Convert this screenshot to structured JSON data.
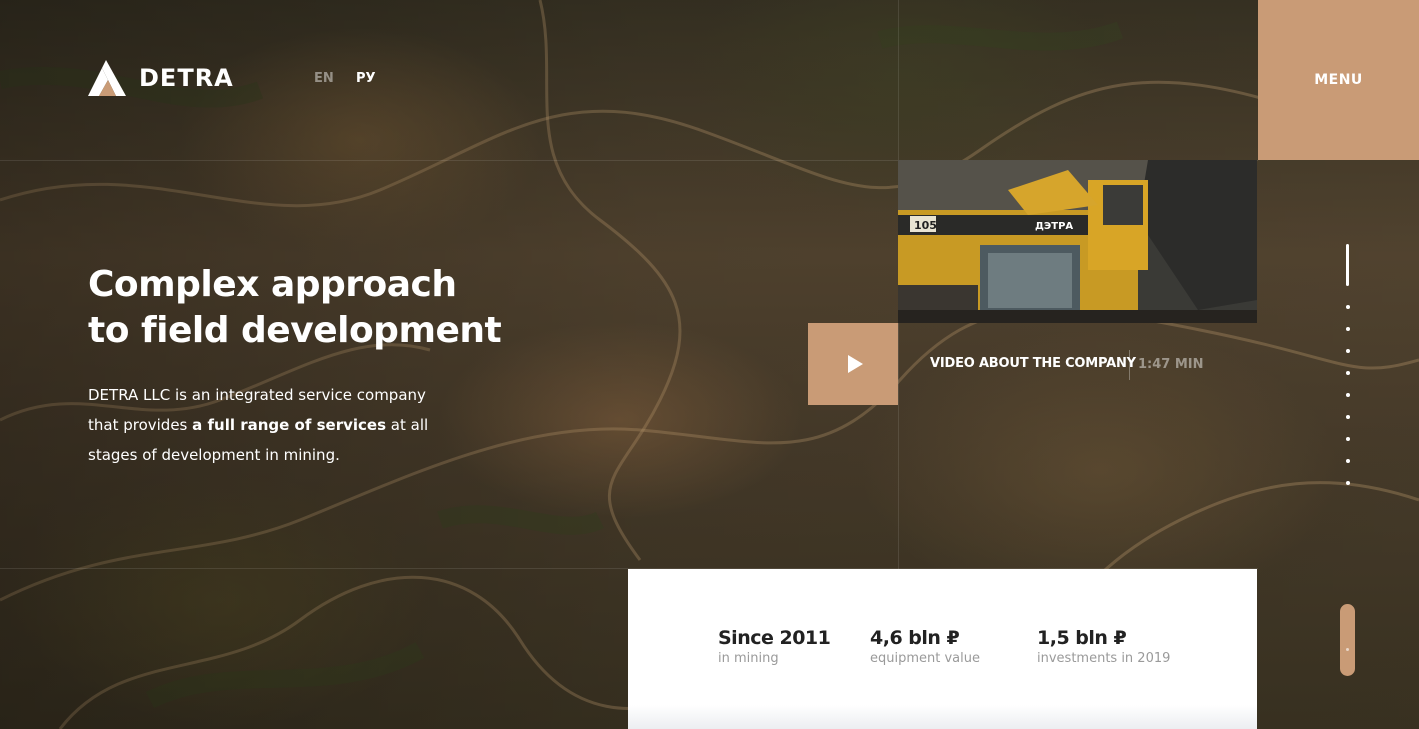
{
  "header": {
    "brand": "DETRA",
    "languages": [
      "EN",
      "РУ"
    ],
    "active_language": "РУ",
    "menu_label": "MENU"
  },
  "hero": {
    "title_line1": "Complex approach",
    "title_line2": "to field development",
    "desc_before": "DETRA LLC is an integrated service company that provides ",
    "desc_bold": "a full range of services",
    "desc_after": " at all stages of development in mining."
  },
  "video": {
    "label": "VIDEO ABOUT THE COMPANY",
    "duration": "1:47 MIN",
    "truck_number": "105",
    "truck_brand": "ДЭТРА"
  },
  "stats": [
    {
      "value": "Since 2011",
      "label": "in mining"
    },
    {
      "value": "4,6 bln ₽",
      "label": "equipment value"
    },
    {
      "value": "1,5 bln ₽",
      "label": "investments in 2019"
    }
  ],
  "pagination": {
    "total": 10,
    "active": 1
  },
  "colors": {
    "accent": "#c99b76",
    "text_light": "#ffffff",
    "stat_value": "#222222",
    "stat_label": "#9a9a9a"
  }
}
